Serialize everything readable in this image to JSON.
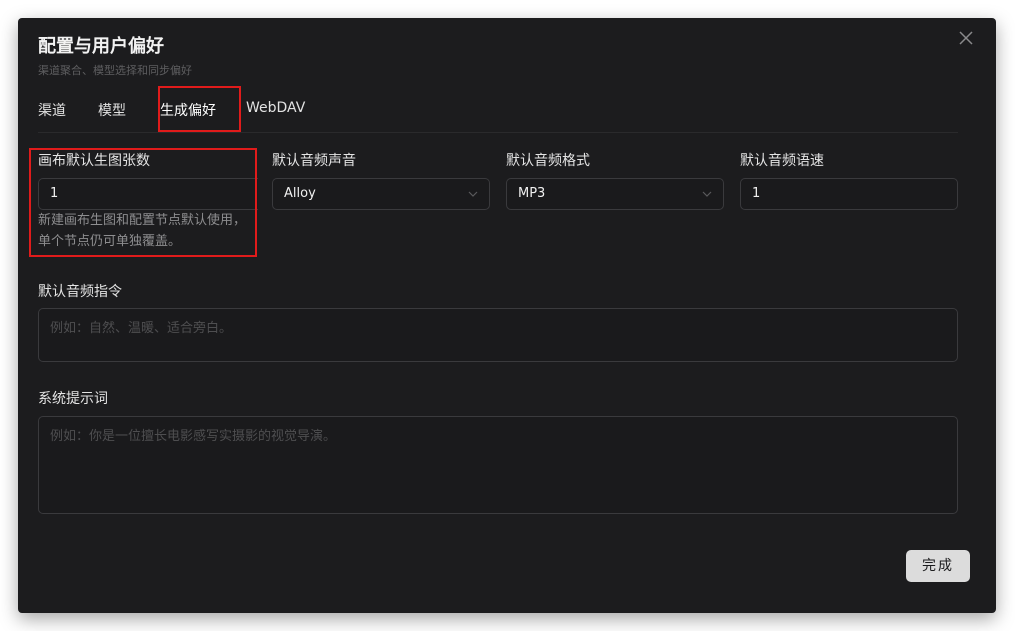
{
  "dialog": {
    "title": "配置与用户偏好",
    "subtitle": "渠道聚合、模型选择和同步偏好"
  },
  "tabs": [
    {
      "label": "渠道"
    },
    {
      "label": "模型"
    },
    {
      "label": "生成偏好"
    },
    {
      "label": "WebDAV"
    }
  ],
  "active_tab": "生成偏好",
  "fields": {
    "canvas_count": {
      "label": "画布默认生图张数",
      "value": "1",
      "hint": "新建画布生图和配置节点默认使用，单个节点仍可单独覆盖。"
    },
    "audio_voice": {
      "label": "默认音频声音",
      "value": "Alloy"
    },
    "audio_format": {
      "label": "默认音频格式",
      "value": "MP3"
    },
    "audio_speed": {
      "label": "默认音频语速",
      "value": "1"
    },
    "audio_instruction": {
      "label": "默认音频指令",
      "placeholder": "例如：自然、温暖、适合旁白。"
    },
    "system_prompt": {
      "label": "系统提示词",
      "placeholder": "例如：你是一位擅长电影感写实摄影的视觉导演。"
    }
  },
  "buttons": {
    "done": "完成"
  },
  "icons": {
    "close": "close-icon",
    "select_arrow": "chevron-down-icon"
  },
  "colors": {
    "dialog_bg": "#1c1c1e",
    "highlight": "#e01b1b",
    "done_bg": "#dcdcdc"
  }
}
